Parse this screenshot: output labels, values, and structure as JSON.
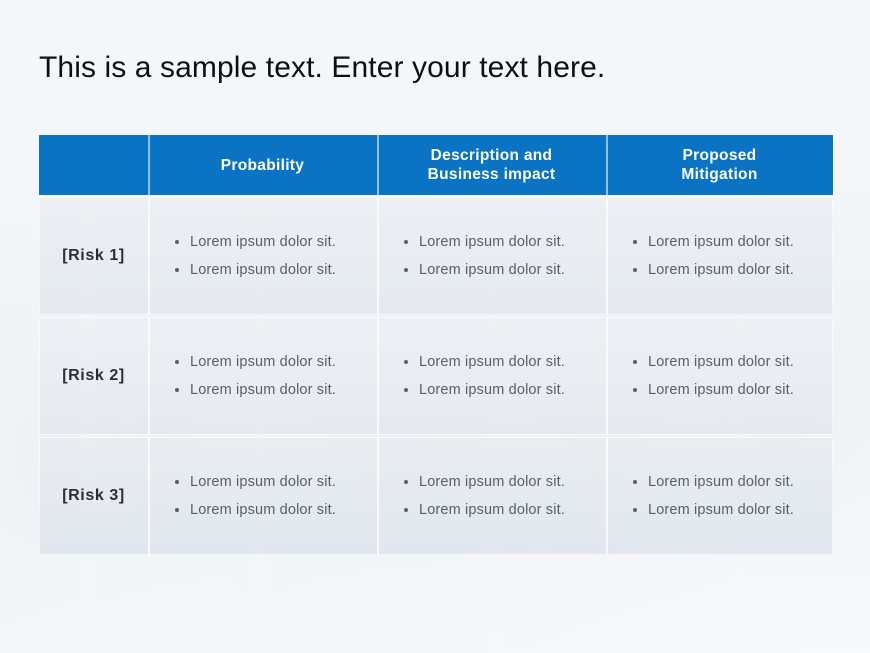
{
  "slide": {
    "title": "This is a sample text. Enter your text here.",
    "accent_color": "#0b73c4",
    "header_text_color": "#ffffff",
    "body_text_color": "#5a5f66",
    "label_text_color": "#2b2f33",
    "row_background_color": "#e6ebf0"
  },
  "table": {
    "headers": {
      "corner": "",
      "col1": "Probability",
      "col2_line1": "Description and",
      "col2_line2": "Business impact",
      "col3_line1": "Proposed",
      "col3_line2": "Mitigation"
    },
    "rows": [
      {
        "label": "[Risk 1]",
        "probability": [
          "Lorem ipsum dolor sit.",
          "Lorem ipsum dolor sit."
        ],
        "description": [
          "Lorem ipsum dolor sit.",
          "Lorem ipsum dolor sit."
        ],
        "mitigation": [
          "Lorem ipsum dolor sit.",
          "Lorem ipsum dolor sit."
        ]
      },
      {
        "label": "[Risk 2]",
        "probability": [
          "Lorem ipsum dolor sit.",
          "Lorem ipsum dolor sit."
        ],
        "description": [
          "Lorem ipsum dolor sit.",
          "Lorem ipsum dolor sit."
        ],
        "mitigation": [
          "Lorem ipsum dolor sit.",
          "Lorem ipsum dolor sit."
        ]
      },
      {
        "label": "[Risk 3]",
        "probability": [
          "Lorem ipsum dolor sit.",
          "Lorem ipsum dolor sit."
        ],
        "description": [
          "Lorem ipsum dolor sit.",
          "Lorem ipsum dolor sit."
        ],
        "mitigation": [
          "Lorem ipsum dolor sit.",
          "Lorem ipsum dolor sit."
        ]
      }
    ]
  }
}
